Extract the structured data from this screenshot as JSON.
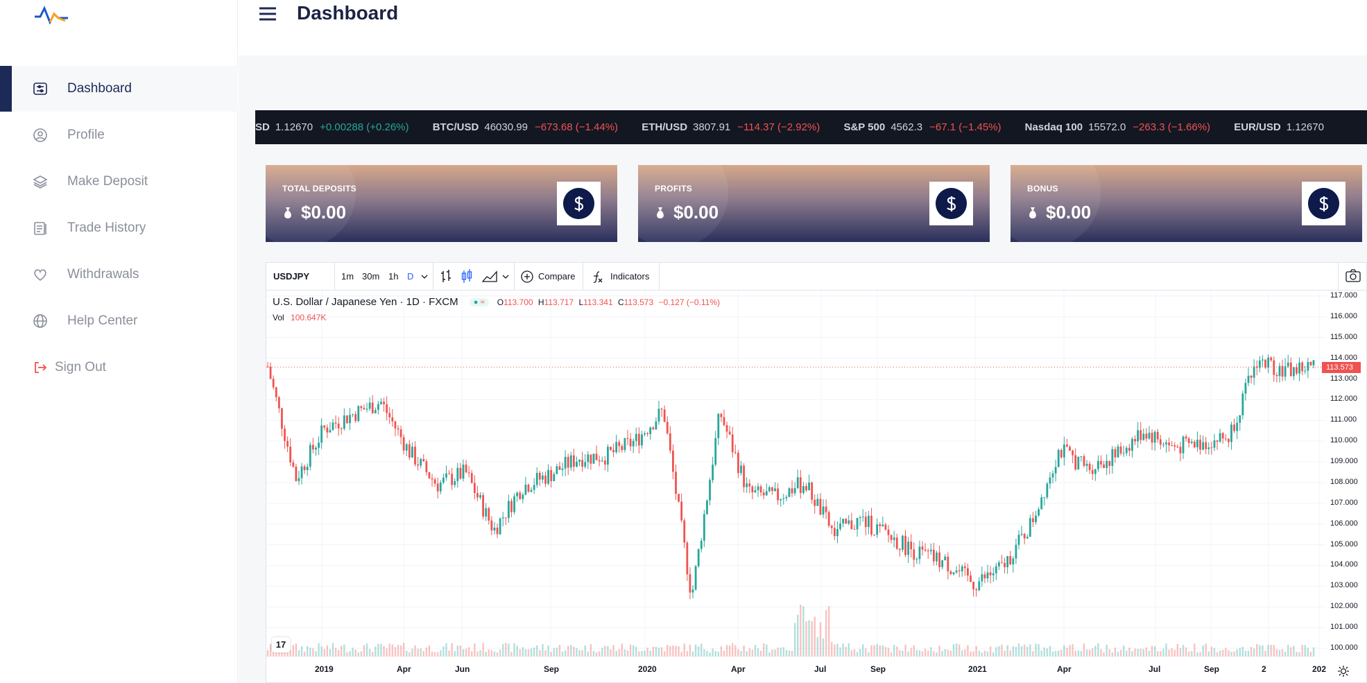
{
  "app": {
    "brand_icon": "pulse-logo-icon"
  },
  "header": {
    "title": "Dashboard",
    "menu_icon": "hamburger-menu-icon"
  },
  "sidebar": {
    "items": [
      {
        "label": "Dashboard",
        "icon": "dashboard-icon",
        "active": true
      },
      {
        "label": "Profile",
        "icon": "profile-icon"
      },
      {
        "label": "Make Deposit",
        "icon": "layers-icon"
      },
      {
        "label": "Trade History",
        "icon": "clipboard-icon"
      },
      {
        "label": "Withdrawals",
        "icon": "heart-icon"
      },
      {
        "label": "Help Center",
        "icon": "globe-icon"
      }
    ],
    "signout": {
      "label": "Sign Out",
      "icon": "logout-icon"
    }
  },
  "ticker": [
    {
      "sym": "SD",
      "price": "1.12670",
      "chg": "+0.00288 (+0.26%)",
      "dir": "up"
    },
    {
      "sym": "BTC/USD",
      "price": "46030.99",
      "chg": "−673.68 (−1.44%)",
      "dir": "down"
    },
    {
      "sym": "ETH/USD",
      "price": "3807.91",
      "chg": "−114.37 (−2.92%)",
      "dir": "down"
    },
    {
      "sym": "S&P 500",
      "price": "4562.3",
      "chg": "−67.1 (−1.45%)",
      "dir": "down"
    },
    {
      "sym": "Nasdaq 100",
      "price": "15572.0",
      "chg": "−263.3 (−1.66%)",
      "dir": "down"
    },
    {
      "sym": "EUR/USD",
      "price": "1.12670",
      "chg": "",
      "dir": "up"
    }
  ],
  "cards": [
    {
      "label": "TOTAL DEPOSITS",
      "value": "$0.00"
    },
    {
      "label": "PROFITS",
      "value": "$0.00"
    },
    {
      "label": "BONUS",
      "value": "$0.00"
    }
  ],
  "chart_toolbar": {
    "symbol": "USDJPY",
    "intervals": [
      "1m",
      "30m",
      "1h",
      "D"
    ],
    "active_interval": "D",
    "compare": "Compare",
    "indicators": "Indicators"
  },
  "chart_legend": {
    "title": "U.S. Dollar / Japanese Yen · 1D · FXCM",
    "o_label": "O",
    "o": "113.700",
    "h_label": "H",
    "h": "113.717",
    "l_label": "L",
    "l": "113.341",
    "c_label": "C",
    "c": "113.573",
    "change": "−0.127 (−0.11%)",
    "vol_label": "Vol",
    "vol": "100.647K",
    "last_price": "113.573"
  },
  "colors": {
    "up": "#26a69a",
    "down": "#ef5350",
    "brand": "#1c2a57"
  },
  "chart_data": {
    "type": "candlestick",
    "title": "",
    "y_ticks": [
      "117.000",
      "116.000",
      "115.000",
      "114.000",
      "113.000",
      "112.000",
      "111.000",
      "110.000",
      "109.000",
      "108.000",
      "107.000",
      "106.000",
      "105.000",
      "104.000",
      "103.000",
      "102.000",
      "101.000",
      "100.000"
    ],
    "ylim": [
      100,
      117
    ],
    "x_ticks": [
      "2019",
      "Apr",
      "Jun",
      "Sep",
      "2020",
      "Apr",
      "Jul",
      "Sep",
      "2021",
      "Apr",
      "Jul",
      "Sep",
      "2",
      "202"
    ],
    "close_path": [
      {
        "x": "2018-12",
        "y": 113.6
      },
      {
        "x": "2019-01-03",
        "y": 108.2
      },
      {
        "x": "2019-02",
        "y": 110.6
      },
      {
        "x": "2019-03",
        "y": 111.3
      },
      {
        "x": "2019-04",
        "y": 111.9
      },
      {
        "x": "2019-05",
        "y": 109.5
      },
      {
        "x": "2019-06",
        "y": 107.9
      },
      {
        "x": "2019-07",
        "y": 108.5
      },
      {
        "x": "2019-08",
        "y": 105.7
      },
      {
        "x": "2019-09",
        "y": 107.8
      },
      {
        "x": "2019-10",
        "y": 108.4
      },
      {
        "x": "2019-11",
        "y": 109.2
      },
      {
        "x": "2019-12",
        "y": 109.3
      },
      {
        "x": "2020-01",
        "y": 110.0
      },
      {
        "x": "2020-02",
        "y": 111.5
      },
      {
        "x": "2020-03-09",
        "y": 102.5
      },
      {
        "x": "2020-03-24",
        "y": 111.4
      },
      {
        "x": "2020-04",
        "y": 107.5
      },
      {
        "x": "2020-05",
        "y": 107.3
      },
      {
        "x": "2020-06",
        "y": 108.0
      },
      {
        "x": "2020-07",
        "y": 105.6
      },
      {
        "x": "2020-08",
        "y": 106.2
      },
      {
        "x": "2020-09",
        "y": 105.4
      },
      {
        "x": "2020-10",
        "y": 104.6
      },
      {
        "x": "2020-11",
        "y": 104.1
      },
      {
        "x": "2020-12",
        "y": 103.1
      },
      {
        "x": "2021-01",
        "y": 103.9
      },
      {
        "x": "2021-02",
        "y": 106.0
      },
      {
        "x": "2021-03",
        "y": 109.6
      },
      {
        "x": "2021-04",
        "y": 108.7
      },
      {
        "x": "2021-05",
        "y": 109.3
      },
      {
        "x": "2021-06",
        "y": 110.5
      },
      {
        "x": "2021-07",
        "y": 109.7
      },
      {
        "x": "2021-08",
        "y": 109.9
      },
      {
        "x": "2021-09",
        "y": 110.2
      },
      {
        "x": "2021-10",
        "y": 113.9
      },
      {
        "x": "2021-11",
        "y": 113.4
      },
      {
        "x": "2021-12",
        "y": 113.6
      }
    ]
  }
}
